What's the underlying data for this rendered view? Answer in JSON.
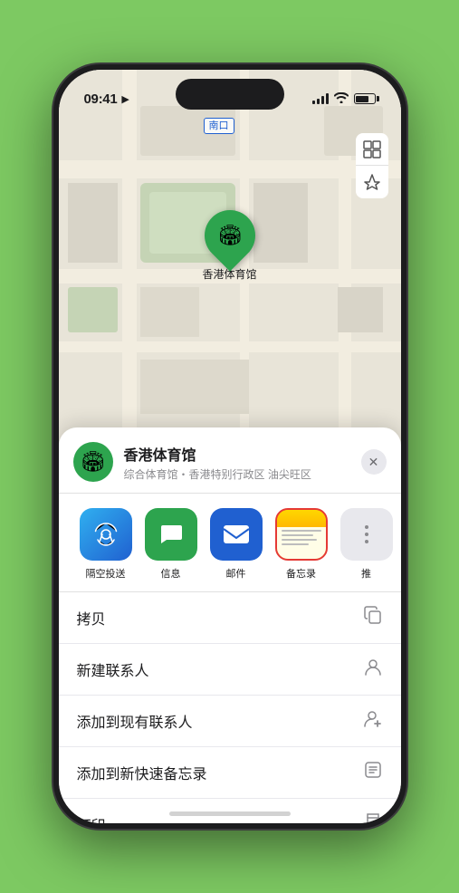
{
  "status_bar": {
    "time": "09:41",
    "location_arrow": "▶"
  },
  "map": {
    "location_label": "南口",
    "pin_label": "香港体育馆",
    "controls": {
      "map_icon": "⊞",
      "location_icon": "➤"
    }
  },
  "venue_sheet": {
    "venue_name": "香港体育馆",
    "venue_subtitle": "综合体育馆・香港特别行政区 油尖旺区",
    "close_label": "✕"
  },
  "share_items": [
    {
      "id": "airdrop",
      "label": "隔空投送",
      "type": "airdrop"
    },
    {
      "id": "messages",
      "label": "信息",
      "type": "messages"
    },
    {
      "id": "mail",
      "label": "邮件",
      "type": "mail"
    },
    {
      "id": "notes",
      "label": "备忘录",
      "type": "notes"
    },
    {
      "id": "more",
      "label": "推",
      "type": "more"
    }
  ],
  "action_items": [
    {
      "id": "copy",
      "label": "拷贝",
      "icon": "⧉"
    },
    {
      "id": "new-contact",
      "label": "新建联系人",
      "icon": "👤"
    },
    {
      "id": "add-contact",
      "label": "添加到现有联系人",
      "icon": "👤"
    },
    {
      "id": "add-notes",
      "label": "添加到新快速备忘录",
      "icon": "📝"
    },
    {
      "id": "print",
      "label": "打印",
      "icon": "🖨"
    }
  ]
}
